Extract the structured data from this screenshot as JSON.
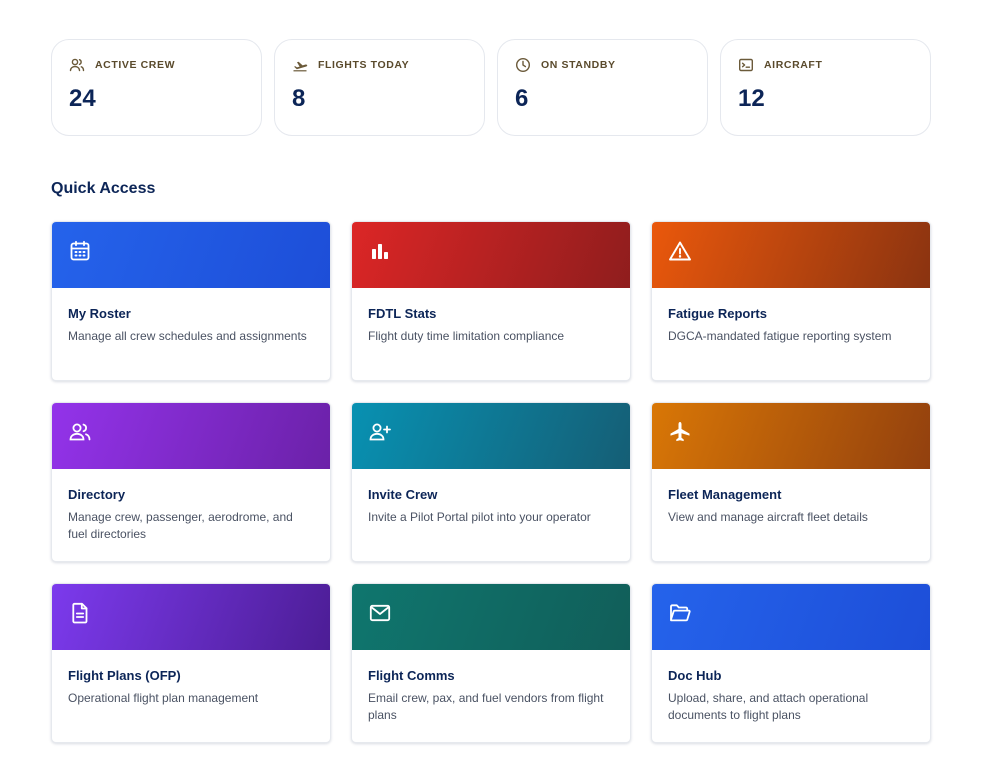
{
  "stats": [
    {
      "label": "ACTIVE CREW",
      "value": "24",
      "icon": "users-icon"
    },
    {
      "label": "FLIGHTS TODAY",
      "value": "8",
      "icon": "plane-departure-icon"
    },
    {
      "label": "ON STANDBY",
      "value": "6",
      "icon": "clock-icon"
    },
    {
      "label": "AIRCRAFT",
      "value": "12",
      "icon": "terminal-icon"
    }
  ],
  "section_title": "Quick Access",
  "cards": [
    {
      "title": "My Roster",
      "desc": "Manage all crew schedules and assignments",
      "icon": "calendar-icon",
      "color": "#2563eb"
    },
    {
      "title": "FDTL Stats",
      "desc": "Flight duty time limitation compliance",
      "icon": "bar-chart-icon",
      "color": "#dc2626"
    },
    {
      "title": "Fatigue Reports",
      "desc": "DGCA-mandated fatigue reporting system",
      "icon": "warning-icon",
      "color": "#ea580c"
    },
    {
      "title": "Directory",
      "desc": "Manage crew, passenger, aerodrome, and fuel directories",
      "icon": "users-icon",
      "color": "#9333ea"
    },
    {
      "title": "Invite Crew",
      "desc": "Invite a Pilot Portal pilot into your operator",
      "icon": "user-plus-icon",
      "color": "#0891b2"
    },
    {
      "title": "Fleet Management",
      "desc": "View and manage aircraft fleet details",
      "icon": "plane-icon",
      "color": "#d97706"
    },
    {
      "title": "Flight Plans (OFP)",
      "desc": "Operational flight plan management",
      "icon": "document-icon",
      "color": "#7c3aed"
    },
    {
      "title": "Flight Comms",
      "desc": "Email crew, pax, and fuel vendors from flight plans",
      "icon": "mail-icon",
      "color": "#0f766e"
    },
    {
      "title": "Doc Hub",
      "desc": "Upload, share, and attach operational documents to flight plans",
      "icon": "folder-open-icon",
      "color": "#2563eb"
    }
  ]
}
